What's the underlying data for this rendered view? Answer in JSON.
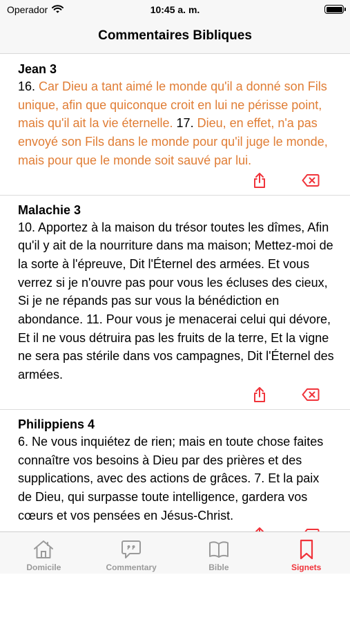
{
  "status_bar": {
    "carrier": "Operador",
    "time": "10:45 a. m."
  },
  "nav": {
    "title": "Commentaires Bibliques"
  },
  "bookmarks": [
    {
      "reference": "Jean 3",
      "segments": [
        {
          "type": "num",
          "text": "16. "
        },
        {
          "type": "hl",
          "text": "Car Dieu a tant aimé le monde qu'il a donné son Fils unique,  afin que quiconque croit en lui ne périsse point, mais qu'il ait la vie éternelle."
        },
        {
          "type": "num",
          "text": " 17. "
        },
        {
          "type": "hl",
          "text": "Dieu, en effet, n'a pas envoyé son Fils dans le monde pour qu'il juge le monde, mais pour que le monde soit sauvé par lui."
        }
      ]
    },
    {
      "reference": "Malachie 3",
      "segments": [
        {
          "type": "num",
          "text": "10. Apportez à la maison du trésor toutes les dîmes, Afin qu'il y ait de la nourriture dans ma maison; Mettez-moi de la sorte à l'épreuve, Dit l'Éternel des armées. Et vous verrez si je n'ouvre pas pour vous les écluses des cieux, Si je ne répands pas sur vous la bénédiction en abondance. 11. Pour vous je menacerai celui qui dévore, Et il ne vous détruira pas les fruits de la terre, Et la vigne ne sera pas stérile dans vos campagnes, Dit l'Éternel des armées."
        }
      ]
    },
    {
      "reference": "Philippiens 4",
      "segments": [
        {
          "type": "num",
          "text": "6. Ne vous inquiétez de rien; mais en toute chose faites connaître vos besoins à Dieu par des prières et des supplications, avec des actions de grâces. 7. Et la paix de Dieu, qui surpasse toute intelligence, gardera vos cœurs et vos pensées en Jésus-Christ."
        }
      ]
    }
  ],
  "tabs": [
    {
      "label": "Domicile",
      "icon": "home-icon",
      "active": false
    },
    {
      "label": "Commentary",
      "icon": "speech-bubble-icon",
      "active": false
    },
    {
      "label": "Bible",
      "icon": "book-icon",
      "active": false
    },
    {
      "label": "Signets",
      "icon": "bookmark-icon",
      "active": true
    }
  ],
  "colors": {
    "accent": "#f0333a",
    "highlight": "#e07d35",
    "inactive": "#9a9a9a"
  }
}
